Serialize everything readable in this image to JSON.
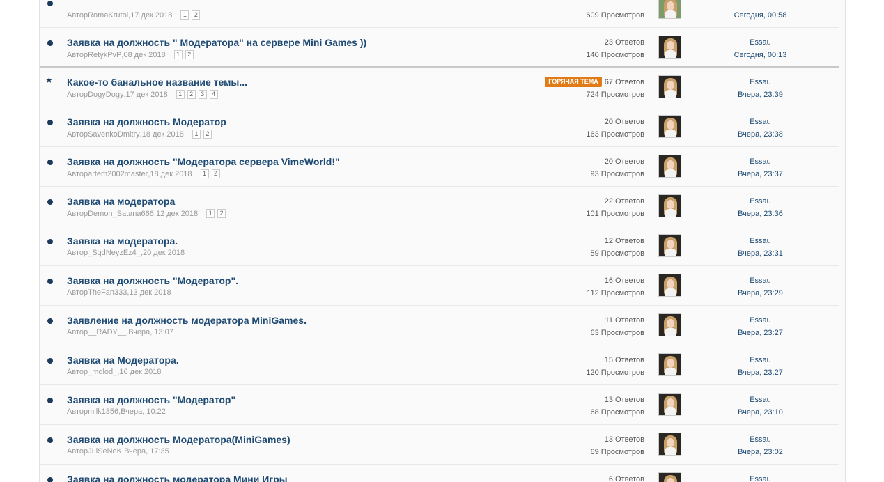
{
  "topics": [
    {
      "marker": "dot",
      "title": "",
      "author_prefix": "Автор",
      "author": "RomaKrutoi",
      "date": "17 дек 2018",
      "pages": [
        "1",
        "2"
      ],
      "hot": "",
      "replies": "",
      "views": "609 Просмотров",
      "last_user": "",
      "last_time": "Сегодня, 00:58"
    },
    {
      "marker": "dot",
      "title": "Заявка на должность \" Модератора\" на сервере Mini Games ))",
      "author_prefix": "Автор",
      "author": "RetykPvP",
      "date": "08 дек 2018",
      "pages": [
        "1",
        "2"
      ],
      "hot": "",
      "replies": "23 Ответов",
      "views": "140 Просмотров",
      "last_user": "Essau",
      "last_time": "Сегодня, 00:13"
    },
    {
      "marker": "star",
      "title": "Какое-то банальное название темы...",
      "author_prefix": "Автор",
      "author": "DogyDogy",
      "date": "17 дек 2018",
      "pages": [
        "1",
        "2",
        "3",
        "4"
      ],
      "hot": "ГОРЯЧАЯ ТЕМА",
      "replies": "67 Ответов",
      "views": "724 Просмотров",
      "last_user": "Essau",
      "last_time": "Вчера, 23:39"
    },
    {
      "marker": "dot",
      "title": "Заявка на должность Модератор",
      "author_prefix": "Автор",
      "author": "SavenkoDmitry",
      "date": "18 дек 2018",
      "pages": [
        "1",
        "2"
      ],
      "hot": "",
      "replies": "20 Ответов",
      "views": "163 Просмотров",
      "last_user": "Essau",
      "last_time": "Вчера, 23:38"
    },
    {
      "marker": "dot",
      "title": "Заявка на должность \"Модератора сервера VimeWorld!\"",
      "author_prefix": "Автор",
      "author": "artem2002master",
      "date": "18 дек 2018",
      "pages": [
        "1",
        "2"
      ],
      "hot": "",
      "replies": "20 Ответов",
      "views": "93 Просмотров",
      "last_user": "Essau",
      "last_time": "Вчера, 23:37"
    },
    {
      "marker": "dot",
      "title": "Заявка на модератора",
      "author_prefix": "Автор",
      "author": "Demon_Satana666",
      "date": "12 дек 2018",
      "pages": [
        "1",
        "2"
      ],
      "hot": "",
      "replies": "22 Ответов",
      "views": "101 Просмотров",
      "last_user": "Essau",
      "last_time": "Вчера, 23:36"
    },
    {
      "marker": "dot",
      "title": "Заявка на модератора.",
      "author_prefix": "Автор",
      "author": "_SqdNeyzEz4_",
      "date": "20 дек 2018",
      "pages": [],
      "hot": "",
      "replies": "12 Ответов",
      "views": "59 Просмотров",
      "last_user": "Essau",
      "last_time": "Вчера, 23:31"
    },
    {
      "marker": "dot",
      "title": "Заявка на должность \"Модератор\".",
      "author_prefix": "Автор",
      "author": "TheFan333",
      "date": "13 дек 2018",
      "pages": [],
      "hot": "",
      "replies": "16 Ответов",
      "views": "112 Просмотров",
      "last_user": "Essau",
      "last_time": "Вчера, 23:29"
    },
    {
      "marker": "dot",
      "title": "Заявление на должность модератора MiniGames.",
      "author_prefix": "Автор",
      "author": "__RADY__",
      "date": "Вчера, 13:07",
      "pages": [],
      "hot": "",
      "replies": "11 Ответов",
      "views": "63 Просмотров",
      "last_user": "Essau",
      "last_time": "Вчера, 23:27"
    },
    {
      "marker": "dot",
      "title": "Заявка на Модератора.",
      "author_prefix": "Автор",
      "author": "_molod_",
      "date": "16 дек 2018",
      "pages": [],
      "hot": "",
      "replies": "15 Ответов",
      "views": "120 Просмотров",
      "last_user": "Essau",
      "last_time": "Вчера, 23:27"
    },
    {
      "marker": "dot",
      "title": "Заявка на должность \"Модератор\"",
      "author_prefix": "Автор",
      "author": "milk1356",
      "date": "Вчера, 10:22",
      "pages": [],
      "hot": "",
      "replies": "13 Ответов",
      "views": "68 Просмотров",
      "last_user": "Essau",
      "last_time": "Вчера, 23:10"
    },
    {
      "marker": "dot",
      "title": "Заявка на должность Модератора(MiniGames)",
      "author_prefix": "Автор",
      "author": "JLiSeNoK",
      "date": "Вчера, 17:35",
      "pages": [],
      "hot": "",
      "replies": "13 Ответов",
      "views": "69 Просмотров",
      "last_user": "Essau",
      "last_time": "Вчера, 23:02"
    },
    {
      "marker": "dot",
      "title": "Заявка на должность модератора Мини Игры",
      "author_prefix": "Автор",
      "author": "",
      "date": "",
      "pages": [],
      "hot": "",
      "replies": "6 Ответов",
      "views": "",
      "last_user": "Essau",
      "last_time": ""
    }
  ],
  "colors": {
    "link": "#1e4a73",
    "marker": "#1c3b5c",
    "hot_badge": "#e07b16"
  },
  "icons": {
    "unread": "dot-icon",
    "pinned": "star-icon"
  }
}
